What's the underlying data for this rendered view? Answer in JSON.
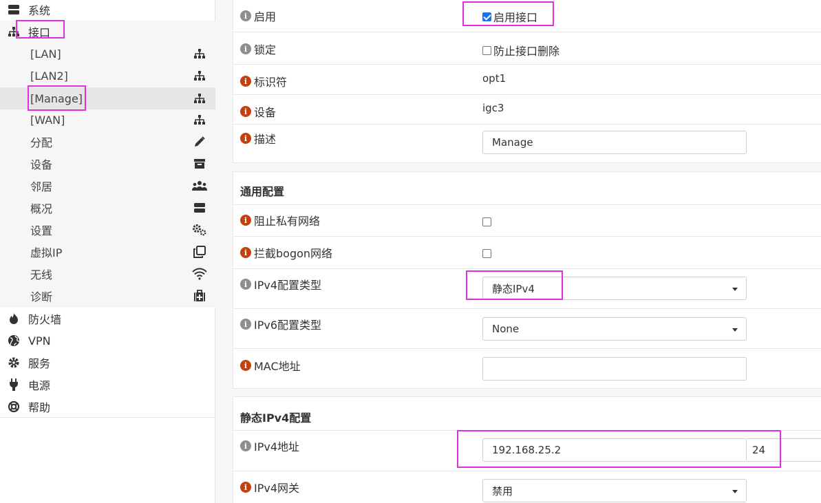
{
  "sidebar": {
    "system": "系统",
    "interfaces": "接口",
    "sub": [
      {
        "label": "[LAN]",
        "icon": "sitemap-icon"
      },
      {
        "label": "[LAN2]",
        "icon": "sitemap-icon"
      },
      {
        "label": "[Manage]",
        "icon": "sitemap-icon"
      },
      {
        "label": "[WAN]",
        "icon": "sitemap-icon"
      },
      {
        "label": "分配",
        "icon": "pencil-icon"
      },
      {
        "label": "设备",
        "icon": "archive-icon"
      },
      {
        "label": "邻居",
        "icon": "users-icon"
      },
      {
        "label": "概况",
        "icon": "server-icon"
      },
      {
        "label": "设置",
        "icon": "gears-icon"
      },
      {
        "label": "虚拟IP",
        "icon": "clone-icon"
      },
      {
        "label": "无线",
        "icon": "wifi-icon"
      },
      {
        "label": "诊断",
        "icon": "medkit-icon"
      }
    ],
    "firewall": "防火墙",
    "vpn": "VPN",
    "services": "服务",
    "power": "电源",
    "help": "帮助"
  },
  "basic": {
    "enable_label": "启用",
    "enable_text": "启用接口",
    "enable_checked": true,
    "lock_label": "锁定",
    "lock_text": "防止接口删除",
    "lock_checked": false,
    "identifier_label": "标识符",
    "identifier_value": "opt1",
    "device_label": "设备",
    "device_value": "igc3",
    "description_label": "描述",
    "description_value": "Manage"
  },
  "general": {
    "title": "通用配置",
    "block_private_label": "阻止私有网络",
    "block_bogon_label": "拦截bogon网络",
    "ipv4_type_label": "IPv4配置类型",
    "ipv4_type_value": "静态IPv4",
    "ipv6_type_label": "IPv6配置类型",
    "ipv6_type_value": "None",
    "mac_label": "MAC地址",
    "mac_value": ""
  },
  "static_ipv4": {
    "title": "静态IPv4配置",
    "address_label": "IPv4地址",
    "address_value": "192.168.25.2",
    "prefix_value": "24",
    "gateway_label": "IPv4网关",
    "gateway_value": "禁用"
  },
  "colors": {
    "highlight": "#e02fe0",
    "info_red": "#c5400f",
    "info_gray": "#8e8e8e"
  }
}
